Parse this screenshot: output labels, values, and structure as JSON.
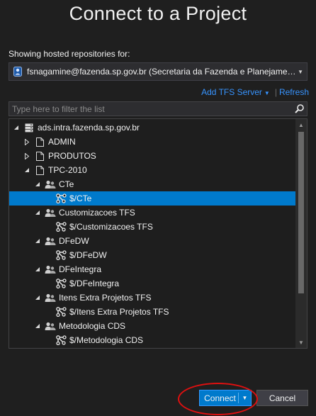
{
  "dialog": {
    "title": "Connect to a Project"
  },
  "account": {
    "showing_label": "Showing hosted repositories for:",
    "selected": "fsnagamine@fazenda.sp.gov.br (Secretaria da Fazenda e Planejamento..."
  },
  "links": {
    "add_tfs_server": "Add TFS Server",
    "separator": "|",
    "refresh": "Refresh"
  },
  "filter": {
    "placeholder": "Type here to filter the list",
    "value": ""
  },
  "tree": {
    "rows": [
      {
        "label": "ads.intra.fazenda.sp.gov.br",
        "level": 0,
        "expander": "expanded",
        "icon": "server-icon"
      },
      {
        "label": "ADMIN",
        "level": 1,
        "expander": "collapsed",
        "icon": "document-icon"
      },
      {
        "label": "PRODUTOS",
        "level": 1,
        "expander": "collapsed",
        "icon": "document-icon"
      },
      {
        "label": "TPC-2010",
        "level": 1,
        "expander": "expanded",
        "icon": "document-icon"
      },
      {
        "label": "CTe",
        "level": 2,
        "expander": "expanded",
        "icon": "team-project-icon"
      },
      {
        "label": "$/CTe",
        "level": 3,
        "expander": "none",
        "icon": "repository-icon",
        "selected": true
      },
      {
        "label": "Customizacoes TFS",
        "level": 2,
        "expander": "expanded",
        "icon": "team-project-icon"
      },
      {
        "label": "$/Customizacoes TFS",
        "level": 3,
        "expander": "none",
        "icon": "repository-icon"
      },
      {
        "label": "DFeDW",
        "level": 2,
        "expander": "expanded",
        "icon": "team-project-icon"
      },
      {
        "label": "$/DFeDW",
        "level": 3,
        "expander": "none",
        "icon": "repository-icon"
      },
      {
        "label": "DFeIntegra",
        "level": 2,
        "expander": "expanded",
        "icon": "team-project-icon"
      },
      {
        "label": "$/DFeIntegra",
        "level": 3,
        "expander": "none",
        "icon": "repository-icon"
      },
      {
        "label": "Itens Extra Projetos TFS",
        "level": 2,
        "expander": "expanded",
        "icon": "team-project-icon"
      },
      {
        "label": "$/Itens Extra Projetos TFS",
        "level": 3,
        "expander": "none",
        "icon": "repository-icon"
      },
      {
        "label": "Metodologia CDS",
        "level": 2,
        "expander": "expanded",
        "icon": "team-project-icon"
      },
      {
        "label": "$/Metodologia CDS",
        "level": 3,
        "expander": "none",
        "icon": "repository-icon"
      }
    ]
  },
  "buttons": {
    "connect": "Connect",
    "cancel": "Cancel"
  },
  "colors": {
    "background": "#1f1f1f",
    "accent": "#007acc",
    "link": "#3794ff",
    "highlight_ellipse": "#e01010"
  }
}
